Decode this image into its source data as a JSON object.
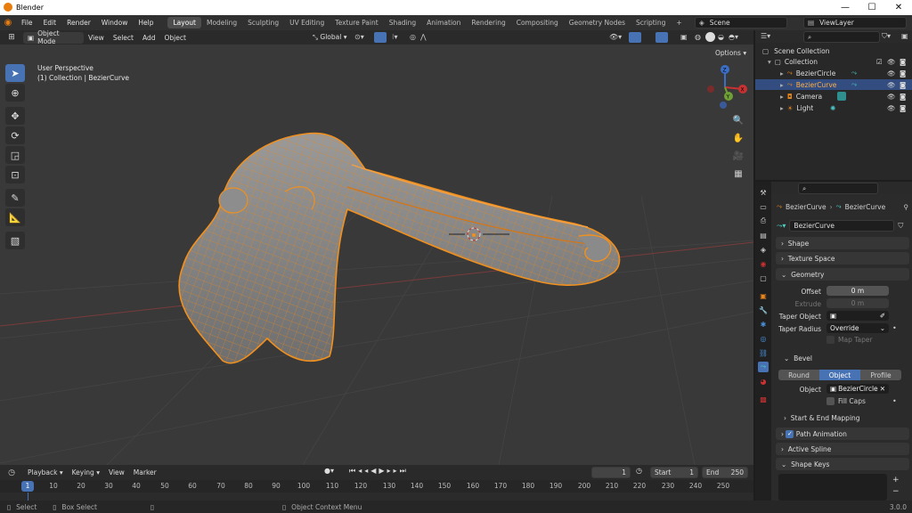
{
  "window": {
    "title": "Blender",
    "minimize": "—",
    "maximize": "☐",
    "close": "✕"
  },
  "menubar": {
    "menus": [
      "File",
      "Edit",
      "Render",
      "Window",
      "Help"
    ],
    "workspaces": [
      "Layout",
      "Modeling",
      "Sculpting",
      "UV Editing",
      "Texture Paint",
      "Shading",
      "Animation",
      "Rendering",
      "Compositing",
      "Geometry Nodes",
      "Scripting"
    ],
    "add_workspace": "+",
    "scene": "Scene",
    "view_layer": "ViewLayer"
  },
  "viewport_header": {
    "mode": "Object Mode",
    "menus": [
      "View",
      "Select",
      "Add",
      "Object"
    ],
    "orientation": "Global",
    "options": "Options"
  },
  "viewport": {
    "perspective": "User Perspective",
    "collection_info": "(1) Collection | BezierCurve",
    "gizmo": {
      "x": "X",
      "y": "Y",
      "z": "Z"
    }
  },
  "timeline": {
    "menus": [
      "Playback",
      "Keying",
      "View",
      "Marker"
    ],
    "current_frame": "1",
    "start_label": "Start",
    "start": "1",
    "end_label": "End",
    "end": "250",
    "frames": [
      "1",
      "10",
      "20",
      "30",
      "40",
      "50",
      "60",
      "70",
      "80",
      "90",
      "100",
      "110",
      "120",
      "130",
      "140",
      "150",
      "160",
      "170",
      "180",
      "190",
      "200",
      "210",
      "220",
      "230",
      "240",
      "250"
    ]
  },
  "status": {
    "select": "Select",
    "box_select": "Box Select",
    "context_menu": "Object Context Menu",
    "version": "3.0.0"
  },
  "outliner": {
    "root": "Scene Collection",
    "collection": "Collection",
    "items": [
      {
        "name": "BezierCircle",
        "selected": false,
        "icon": "curve-icon"
      },
      {
        "name": "BezierCurve",
        "selected": true,
        "icon": "curve-icon"
      },
      {
        "name": "Camera",
        "selected": false,
        "icon": "camera-icon"
      },
      {
        "name": "Light",
        "selected": false,
        "icon": "light-icon"
      }
    ]
  },
  "properties": {
    "breadcrumb_object": "BezierCurve",
    "breadcrumb_data": "BezierCurve",
    "data_name": "BezierCurve",
    "panels": {
      "shape": "Shape",
      "texture_space": "Texture Space",
      "geometry": "Geometry",
      "bevel": "Bevel",
      "start_end_mapping": "Start & End Mapping",
      "path_animation": "Path Animation",
      "active_spline": "Active Spline",
      "shape_keys": "Shape Keys"
    },
    "geometry": {
      "offset_label": "Offset",
      "offset": "0 m",
      "extrude_label": "Extrude",
      "extrude": "0 m",
      "taper_object_label": "Taper Object",
      "taper_radius_label": "Taper Radius",
      "taper_radius": "Override",
      "map_taper": "Map Taper"
    },
    "bevel": {
      "modes": [
        "Round",
        "Object",
        "Profile"
      ],
      "active_mode": "Object",
      "object_label": "Object",
      "object": "BezierCircle",
      "fill_caps": "Fill Caps"
    },
    "shape_keys_add": "+",
    "shape_keys_remove": "−"
  },
  "colors": {
    "accent": "#4772b3",
    "selection": "#e8861c",
    "outliner_selected": "#334d80"
  }
}
